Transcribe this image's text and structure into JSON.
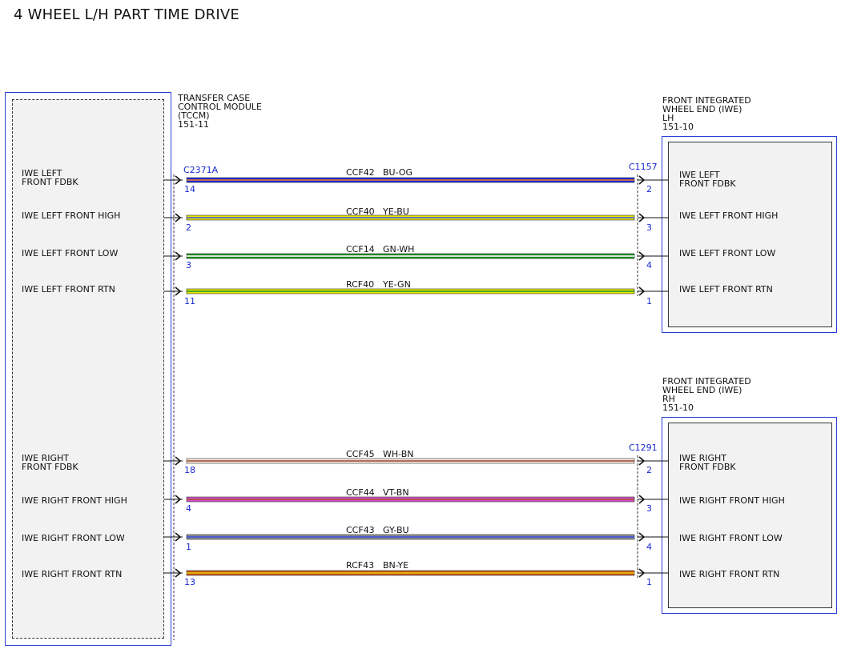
{
  "title": "4 WHEEL L/H PART TIME DRIVE",
  "tccm": {
    "name_lines": [
      "TRANSFER CASE",
      "CONTROL MODULE",
      "(TCCM)"
    ],
    "ref": "151-11",
    "connector": "C2371A",
    "pins": [
      {
        "label_lines": [
          "IWE LEFT",
          "FRONT FDBK"
        ],
        "pin": "14"
      },
      {
        "label_lines": [
          "IWE LEFT FRONT HIGH"
        ],
        "pin": "2"
      },
      {
        "label_lines": [
          "IWE LEFT FRONT LOW"
        ],
        "pin": "3"
      },
      {
        "label_lines": [
          "IWE LEFT FRONT RTN"
        ],
        "pin": "11"
      },
      {
        "label_lines": [
          "IWE RIGHT",
          "FRONT FDBK"
        ],
        "pin": "18"
      },
      {
        "label_lines": [
          "IWE RIGHT FRONT HIGH"
        ],
        "pin": "4"
      },
      {
        "label_lines": [
          "IWE RIGHT FRONT LOW"
        ],
        "pin": "1"
      },
      {
        "label_lines": [
          "IWE RIGHT FRONT RTN"
        ],
        "pin": "13"
      }
    ]
  },
  "iwe_lh": {
    "name_lines": [
      "FRONT INTEGRATED",
      "WHEEL END (IWE)",
      "LH"
    ],
    "ref": "151-10",
    "connector": "C1157",
    "pins": [
      {
        "label_lines": [
          "IWE LEFT",
          "FRONT FDBK"
        ],
        "pin": "2"
      },
      {
        "label_lines": [
          "IWE LEFT FRONT HIGH"
        ],
        "pin": "3"
      },
      {
        "label_lines": [
          "IWE LEFT FRONT LOW"
        ],
        "pin": "4"
      },
      {
        "label_lines": [
          "IWE LEFT FRONT RTN"
        ],
        "pin": "1"
      }
    ]
  },
  "iwe_rh": {
    "name_lines": [
      "FRONT INTEGRATED",
      "WHEEL END (IWE)",
      "RH"
    ],
    "ref": "151-10",
    "connector": "C1291",
    "pins": [
      {
        "label_lines": [
          "IWE RIGHT",
          "FRONT FDBK"
        ],
        "pin": "2"
      },
      {
        "label_lines": [
          "IWE RIGHT FRONT HIGH"
        ],
        "pin": "3"
      },
      {
        "label_lines": [
          "IWE RIGHT FRONT LOW"
        ],
        "pin": "4"
      },
      {
        "label_lines": [
          "IWE RIGHT FRONT RTN"
        ],
        "pin": "1"
      }
    ]
  },
  "wires": [
    {
      "circuit": "CCF42",
      "color_code": "BU-OG",
      "primary": "#1c2ad6",
      "stripe": "#e8792a"
    },
    {
      "circuit": "CCF40",
      "color_code": "YE-BU",
      "primary": "#e6e600",
      "stripe": "#4a5ad8"
    },
    {
      "circuit": "CCF14",
      "color_code": "GN-WH",
      "primary": "#1f8f1f",
      "stripe": "#ffffff"
    },
    {
      "circuit": "RCF40",
      "color_code": "YE-GN",
      "primary": "#e6e600",
      "stripe": "#2a9a2a"
    },
    {
      "circuit": "CCF45",
      "color_code": "WH-BN",
      "primary": "#f4e4e4",
      "stripe": "#a0522d"
    },
    {
      "circuit": "CCF44",
      "color_code": "VT-BN",
      "primary": "#d64fd0",
      "stripe": "#a0522d"
    },
    {
      "circuit": "CCF43",
      "color_code": "GY-BU",
      "primary": "#8c8c8c",
      "stripe": "#3e4ee0"
    },
    {
      "circuit": "RCF43",
      "color_code": "BN-YE",
      "primary": "#c8551c",
      "stripe": "#e6c800"
    }
  ]
}
